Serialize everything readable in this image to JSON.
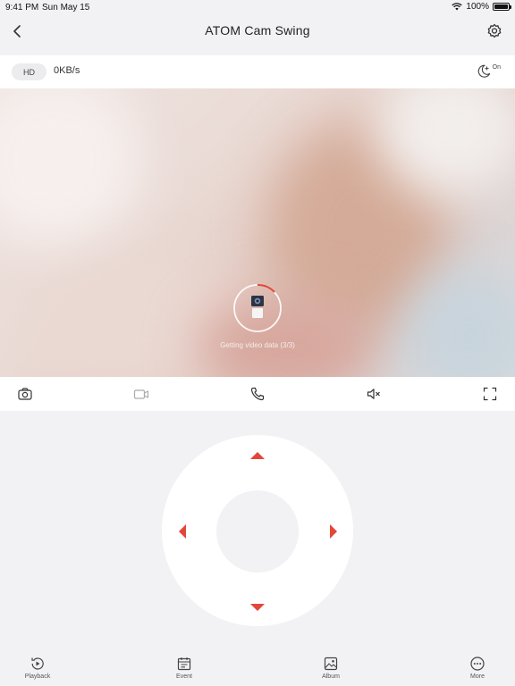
{
  "status_bar": {
    "time": "9:41 PM",
    "date": "Sun May 15",
    "battery": "100%",
    "battery_level": 1.0
  },
  "nav": {
    "title": "ATOM Cam Swing",
    "back_icon": "chevron-left-icon",
    "settings_icon": "gear-icon"
  },
  "quality": {
    "resolution_label": "HD",
    "speed": "0KB/s",
    "night_mode_label": "On",
    "night_mode_icon": "moon-star-icon"
  },
  "video": {
    "loading_text": "Getting video data (3/3)",
    "accent_color": "#e2473a"
  },
  "controls": [
    {
      "name": "screenshot-button",
      "icon": "camera-icon"
    },
    {
      "name": "record-button",
      "icon": "video-icon"
    },
    {
      "name": "talk-button",
      "icon": "phone-icon"
    },
    {
      "name": "mute-button",
      "icon": "speaker-mute-icon"
    },
    {
      "name": "fullscreen-button",
      "icon": "fullscreen-icon"
    }
  ],
  "ptz": {
    "arrow_color": "#e2473a"
  },
  "tabs": [
    {
      "label": "Playback",
      "icon": "playback-icon"
    },
    {
      "label": "Event",
      "icon": "calendar-icon"
    },
    {
      "label": "Album",
      "icon": "image-icon"
    },
    {
      "label": "More",
      "icon": "more-icon"
    }
  ]
}
